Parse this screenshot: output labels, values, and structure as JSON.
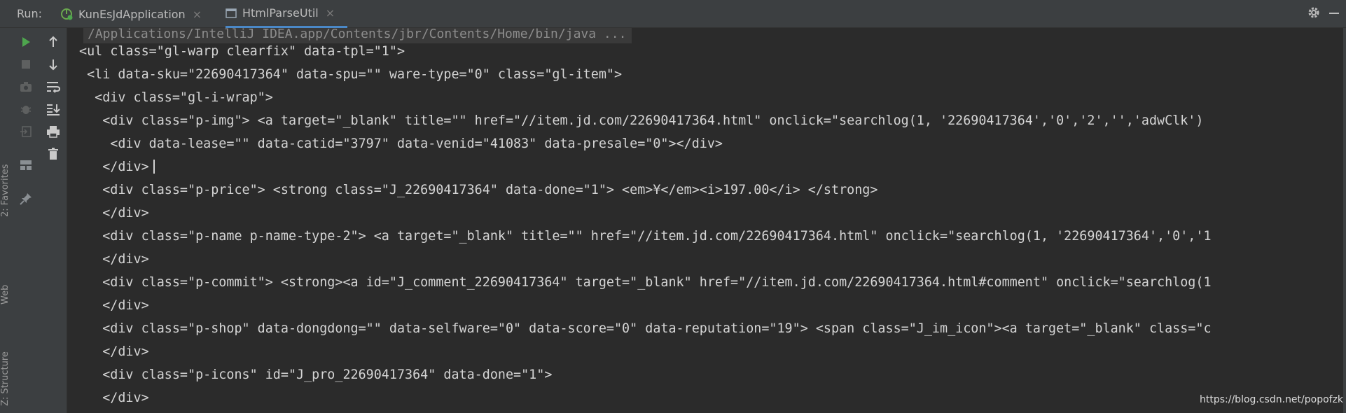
{
  "run_bar": {
    "label": "Run:",
    "tabs": [
      {
        "name": "KunEsJdApplication",
        "active": false
      },
      {
        "name": "HtmlParseUtil",
        "active": true
      }
    ],
    "close_glyph": "×"
  },
  "tool_windows": {
    "favorites": "2: Favorites",
    "web": "Web",
    "structure": "Z: Structure"
  },
  "icons": {
    "settings": "gear-icon",
    "minimize": "minimize-icon",
    "run": "play-icon",
    "stop": "stop-icon",
    "camera": "camera-icon",
    "debug": "bug-icon",
    "exit": "exit-icon",
    "layout": "layout-icon",
    "pin": "pin-icon",
    "up": "arrow-up-icon",
    "down": "arrow-down-icon",
    "wrap": "soft-wrap-icon",
    "scroll_end": "scroll-to-end-icon",
    "print": "print-icon",
    "trash": "trash-icon"
  },
  "colors": {
    "background": "#2b2b2b",
    "panel": "#3c3f41",
    "text": "#d4d4d4",
    "run_green": "#4ea64e",
    "active_tab": "#4a88c7"
  },
  "console": {
    "command": "/Applications/IntelliJ IDEA.app/Contents/jbr/Contents/Home/bin/java ...",
    "lines": [
      "<ul class=\"gl-warp clearfix\" data-tpl=\"1\">",
      " <li data-sku=\"22690417364\" data-spu=\"\" ware-type=\"0\" class=\"gl-item\">",
      "  <div class=\"gl-i-wrap\">",
      "   <div class=\"p-img\"> <a target=\"_blank\" title=\"\" href=\"//item.jd.com/22690417364.html\" onclick=\"searchlog(1, '22690417364','0','2','','adwClk')",
      "    <div data-lease=\"\" data-catid=\"3797\" data-venid=\"41083\" data-presale=\"0\"></div>",
      "   </div>",
      "   <div class=\"p-price\"> <strong class=\"J_22690417364\" data-done=\"1\"> <em>¥</em><i>197.00</i> </strong>",
      "   </div>",
      "   <div class=\"p-name p-name-type-2\"> <a target=\"_blank\" title=\"\" href=\"//item.jd.com/22690417364.html\" onclick=\"searchlog(1, '22690417364','0','1",
      "   </div>",
      "   <div class=\"p-commit\"> <strong><a id=\"J_comment_22690417364\" target=\"_blank\" href=\"//item.jd.com/22690417364.html#comment\" onclick=\"searchlog(1",
      "   </div>",
      "   <div class=\"p-shop\" data-dongdong=\"\" data-selfware=\"0\" data-score=\"0\" data-reputation=\"19\"> <span class=\"J_im_icon\"><a target=\"_blank\" class=\"c",
      "   </div>",
      "   <div class=\"p-icons\" id=\"J_pro_22690417364\" data-done=\"1\">",
      "   </div>"
    ]
  },
  "watermark": "https://blog.csdn.net/popofzk"
}
